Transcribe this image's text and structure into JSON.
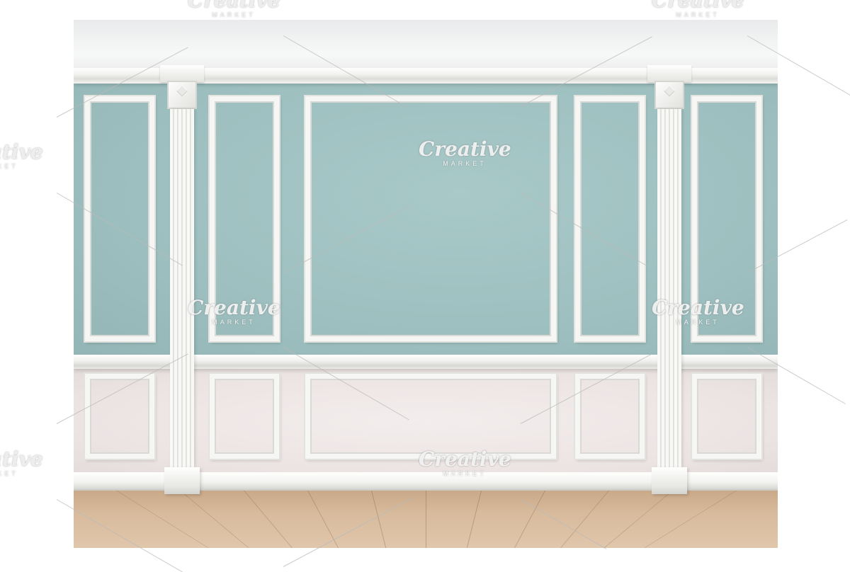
{
  "watermark": {
    "brand": "Creative",
    "sub": "MARKET"
  },
  "colors": {
    "wall_upper": "#9fc0c0",
    "wall_lower": "#ece4e3",
    "molding": "#f6f6f4",
    "floor": "#d8bb9d"
  }
}
